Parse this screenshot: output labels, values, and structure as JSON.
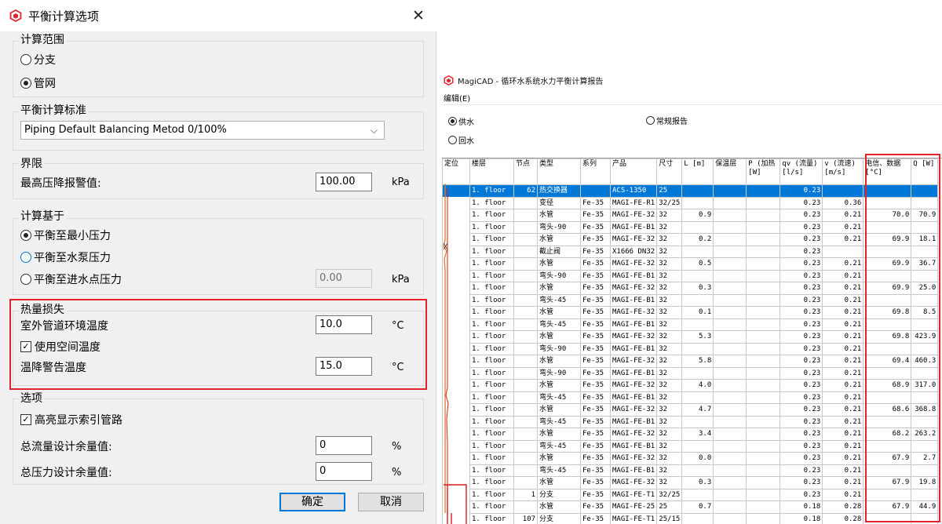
{
  "dialog": {
    "title": "平衡计算选项",
    "close_glyph": "✕",
    "calc_scope": {
      "title": "计算范围",
      "options": [
        {
          "label": "分支",
          "selected": false
        },
        {
          "label": "管网",
          "selected": true
        }
      ]
    },
    "standard": {
      "title": "平衡计算标准",
      "value": "Piping Default Balancing Metod 0/100%"
    },
    "limits": {
      "title": "界限",
      "max_pressure_drop_label": "最高压降报警值:",
      "max_pressure_drop_value": "100.00",
      "unit": "kPa"
    },
    "calc_basis": {
      "title": "计算基于",
      "options": [
        {
          "label": "平衡至最小压力",
          "selected": true
        },
        {
          "label": "平衡至水泵压力",
          "selected": false
        },
        {
          "label": "平衡至进水点压力",
          "selected": false
        }
      ],
      "inlet_value": "0.00",
      "unit": "kPa"
    },
    "heat_loss": {
      "title": "热量损失",
      "outdoor_temp_label": "室外管道环境温度",
      "outdoor_temp_value": "10.0",
      "use_space_temp_label": "使用空间温度",
      "use_space_temp_checked": true,
      "warning_temp_label": "温降警告温度",
      "warning_temp_value": "15.0",
      "unit": "°C"
    },
    "options": {
      "title": "选项",
      "highlight_label": "高亮显示索引管路",
      "highlight_checked": true,
      "flow_margin_label": "总流量设计余量值:",
      "flow_margin_value": "0",
      "pressure_margin_label": "总压力设计余量值:",
      "pressure_margin_value": "0",
      "unit": "%"
    },
    "ok_label": "确定",
    "cancel_label": "取消"
  },
  "report": {
    "title": "MagiCAD - 循环水系统水力平衡计算报告",
    "menu_edit": "编辑(E)",
    "supply_label": "供水",
    "return_label": "回水",
    "normal_report_label": "常规报告",
    "columns": [
      "定位",
      "楼层",
      "节点",
      "类型",
      "系列",
      "产品",
      "尺寸",
      "L [m]",
      "保温层",
      "P (加热 [W]",
      "qv (流量) [l/s]",
      "v (流速) [m/s]",
      "电信、数据 [°C]",
      "Q [W]"
    ],
    "rows": [
      [
        "",
        "1. floor",
        "62",
        "热交换器",
        "",
        "ACS-1350",
        "25",
        "",
        "",
        "",
        "0.23",
        "",
        "",
        ""
      ],
      [
        "",
        "1. floor",
        "",
        "变径",
        "Fe-35",
        "MAGI-FE-R1",
        "32/25",
        "",
        "",
        "",
        "0.23",
        "0.36",
        "",
        ""
      ],
      [
        "",
        "1. floor",
        "",
        "水管",
        "Fe-35",
        "MAGI-FE-32",
        "32",
        "0.9",
        "",
        "",
        "0.23",
        "0.21",
        "70.0",
        "70.9"
      ],
      [
        "",
        "1. floor",
        "",
        "弯头-90",
        "Fe-35",
        "MAGI-FE-B1",
        "32",
        "",
        "",
        "",
        "0.23",
        "0.21",
        "",
        ""
      ],
      [
        "",
        "1. floor",
        "",
        "水管",
        "Fe-35",
        "MAGI-FE-32",
        "32",
        "0.2",
        "",
        "",
        "0.23",
        "0.21",
        "69.9",
        "18.1"
      ],
      [
        "",
        "1. floor",
        "",
        "截止阀",
        "Fe-35",
        "X1666 DN32",
        "32",
        "",
        "",
        "",
        "0.23",
        "",
        "",
        ""
      ],
      [
        "",
        "1. floor",
        "",
        "水管",
        "Fe-35",
        "MAGI-FE-32",
        "32",
        "0.5",
        "",
        "",
        "0.23",
        "0.21",
        "69.9",
        "36.7"
      ],
      [
        "",
        "1. floor",
        "",
        "弯头-90",
        "Fe-35",
        "MAGI-FE-B1",
        "32",
        "",
        "",
        "",
        "0.23",
        "0.21",
        "",
        ""
      ],
      [
        "",
        "1. floor",
        "",
        "水管",
        "Fe-35",
        "MAGI-FE-32",
        "32",
        "0.3",
        "",
        "",
        "0.23",
        "0.21",
        "69.9",
        "25.0"
      ],
      [
        "",
        "1. floor",
        "",
        "弯头-45",
        "Fe-35",
        "MAGI-FE-B1",
        "32",
        "",
        "",
        "",
        "0.23",
        "0.21",
        "",
        ""
      ],
      [
        "",
        "1. floor",
        "",
        "水管",
        "Fe-35",
        "MAGI-FE-32",
        "32",
        "0.1",
        "",
        "",
        "0.23",
        "0.21",
        "69.8",
        "8.5"
      ],
      [
        "",
        "1. floor",
        "",
        "弯头-45",
        "Fe-35",
        "MAGI-FE-B1",
        "32",
        "",
        "",
        "",
        "0.23",
        "0.21",
        "",
        ""
      ],
      [
        "",
        "1. floor",
        "",
        "水管",
        "Fe-35",
        "MAGI-FE-32",
        "32",
        "5.3",
        "",
        "",
        "0.23",
        "0.21",
        "69.8",
        "423.9"
      ],
      [
        "",
        "1. floor",
        "",
        "弯头-90",
        "Fe-35",
        "MAGI-FE-B1",
        "32",
        "",
        "",
        "",
        "0.23",
        "0.21",
        "",
        ""
      ],
      [
        "",
        "1. floor",
        "",
        "水管",
        "Fe-35",
        "MAGI-FE-32",
        "32",
        "5.8",
        "",
        "",
        "0.23",
        "0.21",
        "69.4",
        "460.3"
      ],
      [
        "",
        "1. floor",
        "",
        "弯头-90",
        "Fe-35",
        "MAGI-FE-B1",
        "32",
        "",
        "",
        "",
        "0.23",
        "0.21",
        "",
        ""
      ],
      [
        "",
        "1. floor",
        "",
        "水管",
        "Fe-35",
        "MAGI-FE-32",
        "32",
        "4.0",
        "",
        "",
        "0.23",
        "0.21",
        "68.9",
        "317.0"
      ],
      [
        "",
        "1. floor",
        "",
        "弯头-45",
        "Fe-35",
        "MAGI-FE-B1",
        "32",
        "",
        "",
        "",
        "0.23",
        "0.21",
        "",
        ""
      ],
      [
        "",
        "1. floor",
        "",
        "水管",
        "Fe-35",
        "MAGI-FE-32",
        "32",
        "4.7",
        "",
        "",
        "0.23",
        "0.21",
        "68.6",
        "368.8"
      ],
      [
        "",
        "1. floor",
        "",
        "弯头-45",
        "Fe-35",
        "MAGI-FE-B1",
        "32",
        "",
        "",
        "",
        "0.23",
        "0.21",
        "",
        ""
      ],
      [
        "",
        "1. floor",
        "",
        "水管",
        "Fe-35",
        "MAGI-FE-32",
        "32",
        "3.4",
        "",
        "",
        "0.23",
        "0.21",
        "68.2",
        "263.2"
      ],
      [
        "",
        "1. floor",
        "",
        "弯头-45",
        "Fe-35",
        "MAGI-FE-B1",
        "32",
        "",
        "",
        "",
        "0.23",
        "0.21",
        "",
        ""
      ],
      [
        "",
        "1. floor",
        "",
        "水管",
        "Fe-35",
        "MAGI-FE-32",
        "32",
        "0.0",
        "",
        "",
        "0.23",
        "0.21",
        "67.9",
        "2.7"
      ],
      [
        "",
        "1. floor",
        "",
        "弯头-45",
        "Fe-35",
        "MAGI-FE-B1",
        "32",
        "",
        "",
        "",
        "0.23",
        "0.21",
        "",
        ""
      ],
      [
        "",
        "1. floor",
        "",
        "水管",
        "Fe-35",
        "MAGI-FE-32",
        "32",
        "0.3",
        "",
        "",
        "0.23",
        "0.21",
        "67.9",
        "19.8"
      ],
      [
        "",
        "1. floor",
        "1",
        "分支",
        "Fe-35",
        "MAGI-FE-T1",
        "32/25",
        "",
        "",
        "",
        "0.23",
        "0.21",
        "",
        ""
      ],
      [
        "",
        "1. floor",
        "",
        "水管",
        "Fe-35",
        "MAGI-FE-25",
        "25",
        "0.7",
        "",
        "",
        "0.18",
        "0.28",
        "67.9",
        "44.9"
      ],
      [
        "",
        "1. floor",
        "107",
        "分支",
        "Fe-35",
        "MAGI-FE-T1",
        "25/15",
        "",
        "",
        "",
        "0.18",
        "0.28",
        "",
        ""
      ]
    ],
    "numeric_columns": [
      2,
      7,
      10,
      11,
      12,
      13
    ],
    "selected_row": 0,
    "colors": {
      "selection": "#0078d7",
      "highlight_box": "#e2232e",
      "pipe_line_orange": "#e07a2a",
      "pipe_line_red": "#d81c1c"
    }
  }
}
